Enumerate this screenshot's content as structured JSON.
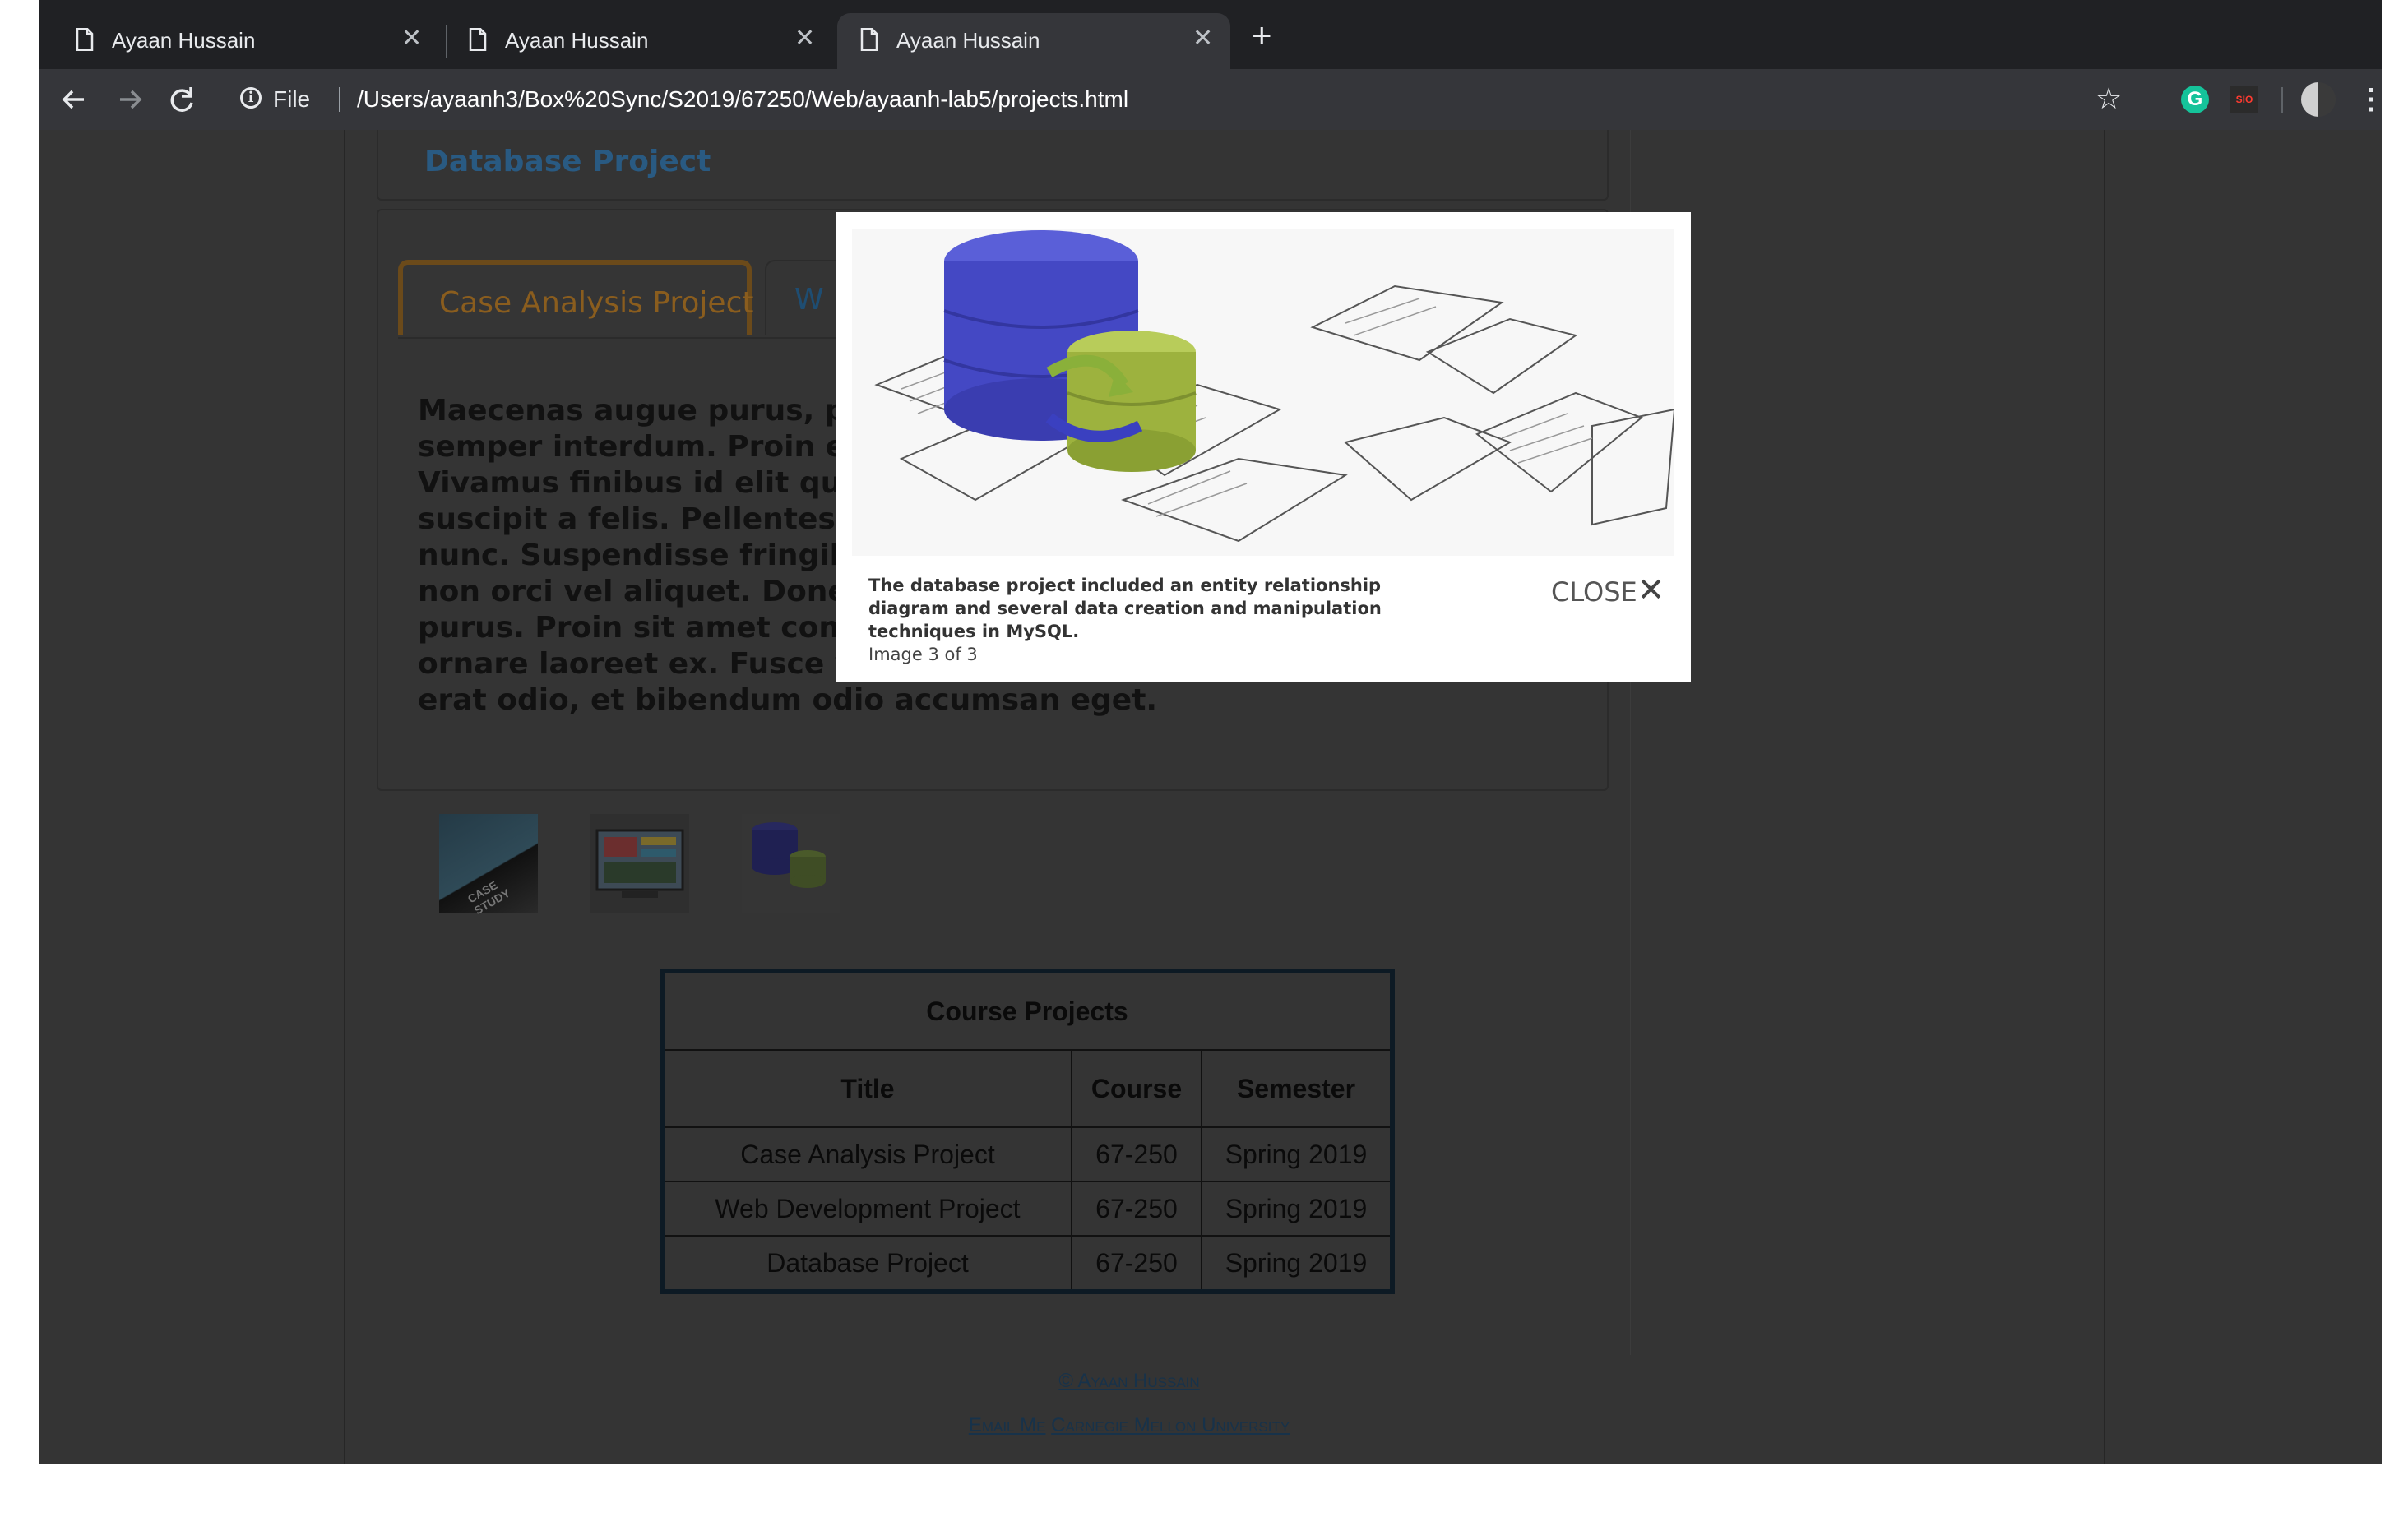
{
  "browser": {
    "tabs": [
      {
        "title": "Ayaan Hussain",
        "active": false
      },
      {
        "title": "Ayaan Hussain",
        "active": false
      },
      {
        "title": "Ayaan Hussain",
        "active": true
      }
    ],
    "close_glyph": "✕",
    "new_tab_glyph": "+",
    "url_scheme": "File",
    "url_path": "/Users/ayaanh3/Box%20Sync/S2019/67250/Web/ayaanh-lab5/projects.html",
    "extensions": {
      "grammarly_letter": "G",
      "sio_label": "SIO"
    }
  },
  "page": {
    "section_header": "Database Project",
    "tabs": [
      "Case Analysis Project",
      "W"
    ],
    "panel_text": "Maecenas augue purus, pos … semper interdum. Proin eu",
    "panel_lines": [
      "Maecenas augue purus, pos",
      "semper interdum. Proin eu",
      "Vivamus finibus id elit quis",
      "suscipit a felis. Pellentesqu",
      "nunc. Suspendisse fringilla",
      "non orci vel aliquet. Donec",
      "purus. Proin sit amet conva",
      "ornare laoreet ex. Fusce v",
      "erat odio, et bibendum odio accumsan eget."
    ],
    "thumbnails": [
      "case-study-thumbnail",
      "web-development-thumbnail",
      "database-thumbnail"
    ],
    "thumb1_text": "CASE STUDY",
    "table": {
      "caption": "Course Projects",
      "headers": [
        "Title",
        "Course",
        "Semester"
      ],
      "rows": [
        [
          "Case Analysis Project",
          "67-250",
          "Spring 2019"
        ],
        [
          "Web Development Project",
          "67-250",
          "Spring 2019"
        ],
        [
          "Database Project",
          "67-250",
          "Spring 2019"
        ]
      ]
    },
    "footer": {
      "copyright": "© Ayaan Hussain",
      "email": "Email Me",
      "university": "Carnegie Mellon University"
    }
  },
  "lightbox": {
    "caption": "The database project included an entity relationship diagram and several data creation and manipulation techniques in MySQL.",
    "number": "Image 3 of 3",
    "close_label": "CLOSE",
    "close_glyph": "✕"
  },
  "colors": {
    "tab_accent": "#8a5d1e",
    "link_blue": "#295a82",
    "overlay_bg": "#343434"
  }
}
